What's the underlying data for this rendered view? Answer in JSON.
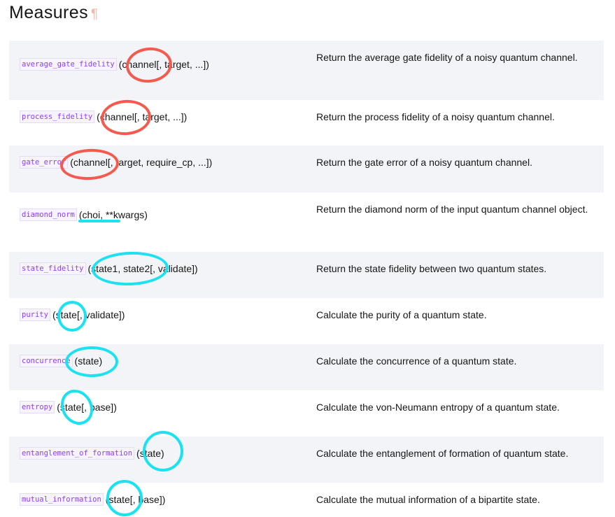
{
  "section": {
    "title": "Measures",
    "anchor": "¶"
  },
  "rows": [
    {
      "name": "average_gate_fidelity",
      "signature": "(channel[, target, ...])",
      "description": "Return the average gate fidelity of a noisy quantum channel."
    },
    {
      "name": "process_fidelity",
      "signature": "(channel[, target, ...])",
      "description": "Return the process fidelity of a noisy quantum channel."
    },
    {
      "name": "gate_error",
      "signature": "(channel[, target, require_cp, ...])",
      "description": "Return the gate error of a noisy quantum channel."
    },
    {
      "name": "diamond_norm",
      "signature": "(choi, **kwargs)",
      "description": "Return the diamond norm of the input quantum channel object."
    },
    {
      "name": "state_fidelity",
      "signature": "(state1, state2[, validate])",
      "description": "Return the state fidelity between two quantum states."
    },
    {
      "name": "purity",
      "signature": "(state[, validate])",
      "description": "Calculate the purity of a quantum state."
    },
    {
      "name": "concurrence",
      "signature": "(state)",
      "description": "Calculate the concurrence of a quantum state."
    },
    {
      "name": "entropy",
      "signature": "(state[, base])",
      "description": "Calculate the von-Neumann entropy of a quantum state."
    },
    {
      "name": "entanglement_of_formation",
      "signature": "(state)",
      "description": "Calculate the entanglement of formation of quantum state."
    },
    {
      "name": "mutual_information",
      "signature": "(state[, base])",
      "description": "Calculate the mutual information of a bipartite state."
    }
  ],
  "colors": {
    "code_text": "#8a3ffc",
    "row_alt_bg": "#f2f4f8",
    "annotation_red": "#f45a4e",
    "annotation_cyan": "#1ce1ee"
  }
}
